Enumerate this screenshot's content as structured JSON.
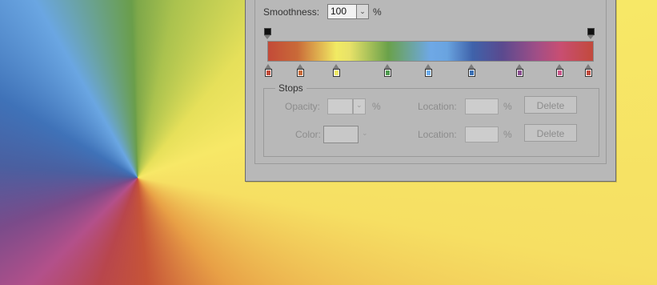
{
  "colors": {
    "dialog_bg": "#b8b8b8"
  },
  "smoothness": {
    "label": "Smoothness:",
    "value": "100",
    "unit": "%",
    "dropdown_icon": "chevron-down-icon"
  },
  "gradient": {
    "opacity_stops": [
      "#000000",
      "#000000"
    ],
    "color_stops": [
      "#c34a38",
      "#c96a38",
      "#f1ea63",
      "#4e9a4e",
      "#6eaef0",
      "#3a6fb3",
      "#8a4e90",
      "#c9568a",
      "#c24a3c"
    ]
  },
  "stops": {
    "title": "Stops",
    "opacity_label": "Opacity:",
    "opacity_unit": "%",
    "color_label": "Color:",
    "location_label_1": "Location:",
    "location_unit_1": "%",
    "location_label_2": "Location:",
    "location_unit_2": "%",
    "delete_label_1": "Delete",
    "delete_label_2": "Delete"
  }
}
